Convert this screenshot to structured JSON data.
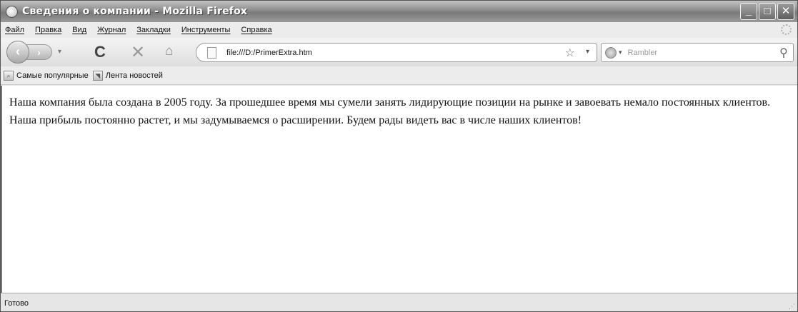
{
  "window": {
    "title": "Сведения о компании - Mozilla Firefox",
    "minimize_glyph": "_",
    "maximize_glyph": "□",
    "close_glyph": "✕"
  },
  "menu": {
    "items": [
      "Файл",
      "Правка",
      "Вид",
      "Журнал",
      "Закладки",
      "Инструменты",
      "Справка"
    ]
  },
  "navigation": {
    "back_glyph": "‹",
    "forward_glyph": "›",
    "history_dropdown_glyph": "▾",
    "reload_glyph": "C",
    "stop_glyph": "✕",
    "home_glyph": "⌂",
    "url": "file:///D:/PrimerExtra.htm",
    "bookmark_star_glyph": "☆",
    "url_dropdown_glyph": "▾",
    "search_engine_dropdown_glyph": "▾",
    "search_placeholder": "Rambler",
    "search_glyph": "⚲"
  },
  "bookmarks": {
    "items": [
      {
        "label": "Самые популярные",
        "icon": "search-page-icon"
      },
      {
        "label": "Лента новостей",
        "icon": "rss-feed-icon"
      }
    ]
  },
  "page": {
    "text": "Наша компания была создана в 2005 году. За прошедшее время мы сумели занять лидирующие позиции на рынке и завоевать немало постоянных клиентов. Наша прибыль постоянно растет, и мы задумываемся о расширении. Будем рады видеть вас в числе наших клиентов!"
  },
  "status": {
    "text": "Готово"
  }
}
